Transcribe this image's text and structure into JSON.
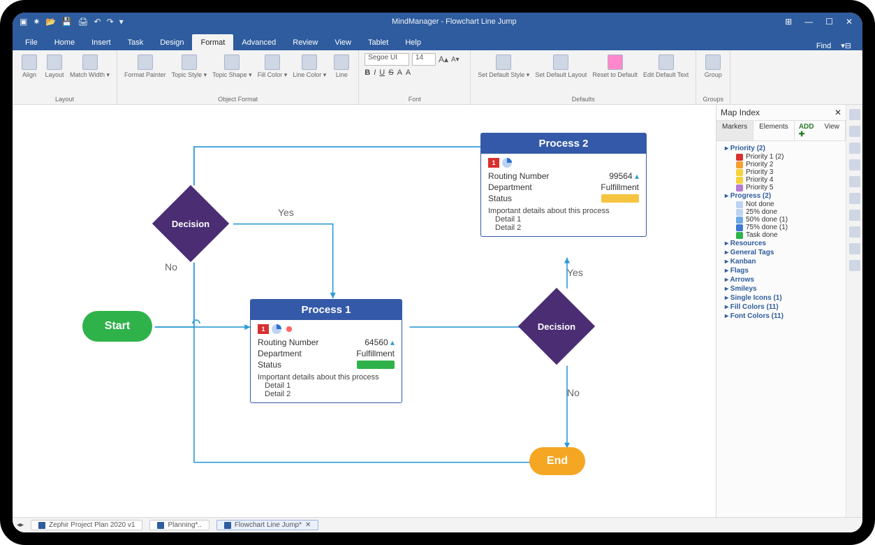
{
  "title": "MindManager - Flowchart Line Jump",
  "menu": {
    "tabs": [
      "File",
      "Home",
      "Insert",
      "Task",
      "Design",
      "Format",
      "Advanced",
      "Review",
      "View",
      "Tablet",
      "Help"
    ],
    "active": "Format",
    "find": "Find"
  },
  "ribbon": {
    "groups": [
      {
        "name": "Layout",
        "buttons": [
          "Align",
          "Layout",
          "Match Width ▾"
        ]
      },
      {
        "name": "Object Format",
        "buttons": [
          "Format Painter",
          "Topic Style ▾",
          "Topic Shape ▾",
          "Fill Color ▾",
          "Line Color ▾",
          "Line"
        ]
      },
      {
        "name": "Font",
        "font_name": "Segoe UI",
        "font_size": "14",
        "buttons": [
          "B",
          "I",
          "U",
          "S",
          "A",
          "A"
        ]
      },
      {
        "name": "Defaults",
        "buttons": [
          "Set Default Style ▾",
          "Set Default Layout",
          "Reset to Default",
          "Edit Default Text"
        ]
      },
      {
        "name": "Groups",
        "buttons": [
          "Group"
        ]
      }
    ]
  },
  "flow": {
    "start": "Start",
    "end": "End",
    "decision": "Decision",
    "labels": {
      "yes": "Yes",
      "no": "No"
    },
    "p1": {
      "title": "Process 1",
      "badge": "1",
      "rows": [
        {
          "k": "Routing Number",
          "v": "64560"
        },
        {
          "k": "Department",
          "v": "Fulfillment"
        },
        {
          "k": "Status",
          "v": "",
          "color": "#2fb24a"
        }
      ],
      "detail_h": "Important details about this process",
      "details": [
        "Detail 1",
        "Detail 2"
      ]
    },
    "p2": {
      "title": "Process 2",
      "badge": "1",
      "rows": [
        {
          "k": "Routing Number",
          "v": "99564"
        },
        {
          "k": "Department",
          "v": "Fulfillment"
        },
        {
          "k": "Status",
          "v": "",
          "color": "#f5c542"
        }
      ],
      "detail_h": "Important details about this process",
      "details": [
        "Detail 1",
        "Detail 2"
      ]
    }
  },
  "mapindex": {
    "title": "Map Index",
    "subtabs": [
      "Markers",
      "Elements"
    ],
    "add": "ADD",
    "view": "View",
    "tree": [
      {
        "cat": "Priority (2)",
        "items": [
          {
            "sw": "#d93030",
            "t": "Priority 1 (2)"
          },
          {
            "sw": "#f59f2f",
            "t": "Priority 2"
          },
          {
            "sw": "#f5d23a",
            "t": "Priority 3"
          },
          {
            "sw": "#f5d23a",
            "t": "Priority 4"
          },
          {
            "sw": "#b57bd6",
            "t": "Priority 5"
          }
        ]
      },
      {
        "cat": "Progress (2)",
        "items": [
          {
            "sw": "#bcd3f2",
            "t": "Not done"
          },
          {
            "sw": "#bcd3f2",
            "t": "25% done"
          },
          {
            "sw": "#6fa9e6",
            "t": "50% done (1)"
          },
          {
            "sw": "#3d7bd1",
            "t": "75% done (1)"
          },
          {
            "sw": "#2fb24a",
            "t": "Task done"
          }
        ]
      },
      {
        "cat": "Resources"
      },
      {
        "cat": "General Tags"
      },
      {
        "cat": "Kanban"
      },
      {
        "cat": "Flags"
      },
      {
        "cat": "Arrows"
      },
      {
        "cat": "Smileys"
      },
      {
        "cat": "Single Icons (1)"
      },
      {
        "cat": "Fill Colors (11)"
      },
      {
        "cat": "Font Colors (11)"
      }
    ]
  },
  "doctabs": [
    "Zephir Project Plan 2020 v1",
    "Planning*..",
    "Flowchart Line Jump*"
  ]
}
